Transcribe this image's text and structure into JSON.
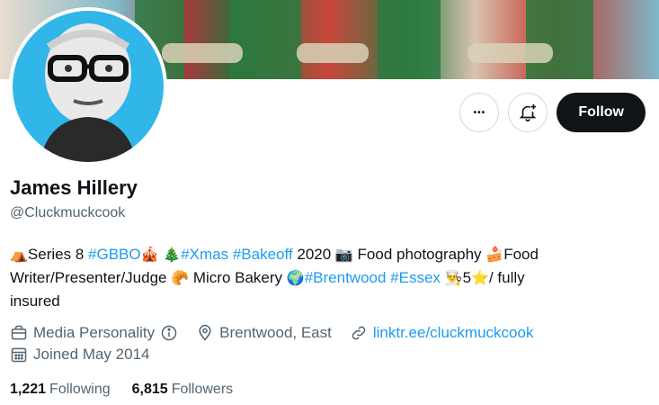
{
  "profile": {
    "display_name": "James Hillery",
    "handle": "@Cluckmuckcook"
  },
  "actions": {
    "more_icon": "more-horizontal-icon",
    "more_glyph": "•••",
    "notify_icon": "bell-plus-icon",
    "follow_label": "Follow"
  },
  "bio": {
    "line1": {
      "emoji1": "⛺",
      "t1": "Series 8 ",
      "tag1": "#GBBO",
      "emoji2": "🎪",
      "emoji3": "🎄",
      "tag2": "#Xmas",
      "tag3": "#Bakeoff",
      "t2": " 2020 ",
      "emoji4": "📷",
      "t3": " Food photography ",
      "emoji5": "🍰",
      "t4": "Food"
    },
    "line2": {
      "t1": "Writer/Presenter/Judge ",
      "emoji1": "🥐",
      "t2": " Micro Bakery ",
      "emoji2": "🌍",
      "tag1": "#Brentwood",
      "tag2": "#Essex",
      "emoji3": "👨‍🍳",
      "t3": "5",
      "emoji4": "⭐",
      "t4": "/ fully"
    },
    "line3": "insured"
  },
  "meta": {
    "category": "Media Personality",
    "category_icon": "briefcase-icon",
    "info_icon": "info-icon",
    "location": "Brentwood, East",
    "location_icon": "location-pin-icon",
    "website": "linktr.ee/cluckmuckcook",
    "website_icon": "link-icon",
    "joined": "Joined May 2014",
    "joined_icon": "calendar-icon"
  },
  "stats": {
    "following_count": "1,221",
    "following_label": "Following",
    "followers_count": "6,815",
    "followers_label": "Followers"
  },
  "colors": {
    "accent": "#1d9bf0",
    "text": "#0f1419",
    "muted": "#536471",
    "follow_bg": "#0f1419"
  }
}
